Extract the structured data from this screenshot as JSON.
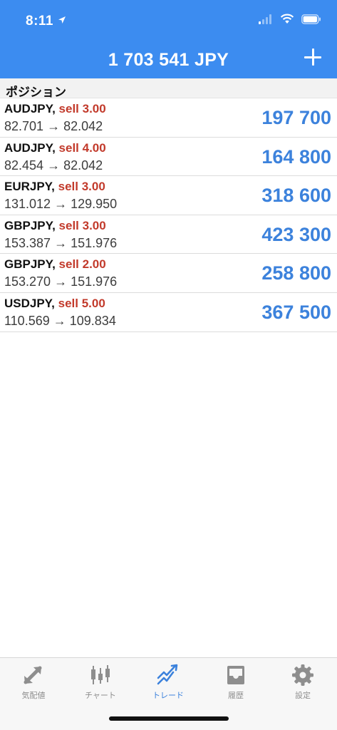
{
  "status_bar": {
    "time": "8:11",
    "location_icon": "location-arrow-icon",
    "signal_icon": "cellular-signal-icon",
    "wifi_icon": "wifi-icon",
    "battery_icon": "battery-icon"
  },
  "header": {
    "title": "1 703 541 JPY",
    "add_icon": "plus-icon",
    "background": "#3c8cf0"
  },
  "section": {
    "title": "ポジション"
  },
  "positions": [
    {
      "symbol": "AUDJPY,",
      "direction": "sell 3.00",
      "open": "82.701",
      "arrow": "→",
      "current": "82.042",
      "profit": "197 700"
    },
    {
      "symbol": "AUDJPY,",
      "direction": "sell 4.00",
      "open": "82.454",
      "arrow": "→",
      "current": "82.042",
      "profit": "164 800"
    },
    {
      "symbol": "EURJPY,",
      "direction": "sell 3.00",
      "open": "131.012",
      "arrow": "→",
      "current": "129.950",
      "profit": "318 600"
    },
    {
      "symbol": "GBPJPY,",
      "direction": "sell 3.00",
      "open": "153.387",
      "arrow": "→",
      "current": "151.976",
      "profit": "423 300"
    },
    {
      "symbol": "GBPJPY,",
      "direction": "sell 2.00",
      "open": "153.270",
      "arrow": "→",
      "current": "151.976",
      "profit": "258 800"
    },
    {
      "symbol": "USDJPY,",
      "direction": "sell 5.00",
      "open": "110.569",
      "arrow": "→",
      "current": "109.834",
      "profit": "367 500"
    }
  ],
  "colors": {
    "sell": "#c23a2b",
    "profit": "#3c82dc",
    "tab_active": "#3c82dc",
    "tab_inactive": "#8e8e8e"
  },
  "tabbar": {
    "tabs": [
      {
        "label": "気配値",
        "icon": "quotes-arrows-icon",
        "active": false
      },
      {
        "label": "チャート",
        "icon": "candlestick-chart-icon",
        "active": false
      },
      {
        "label": "トレード",
        "icon": "trade-trend-icon",
        "active": true
      },
      {
        "label": "履歴",
        "icon": "history-tray-icon",
        "active": false
      },
      {
        "label": "設定",
        "icon": "gear-icon",
        "active": false
      }
    ]
  }
}
